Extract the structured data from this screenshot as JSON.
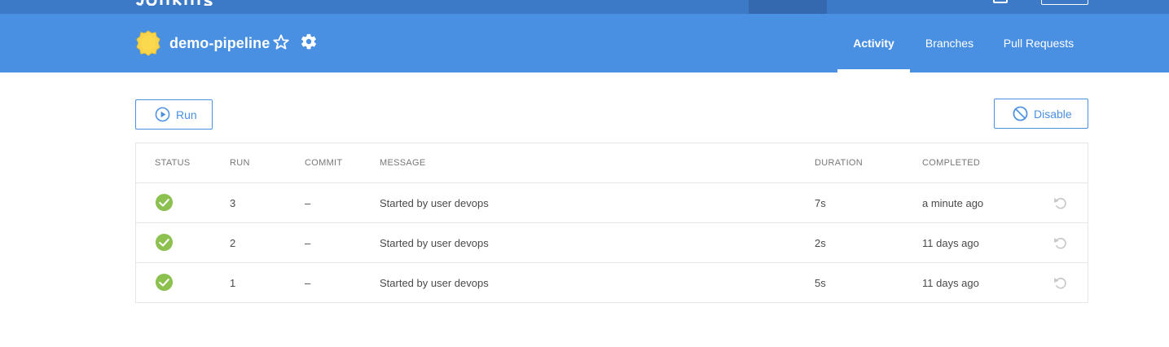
{
  "header": {
    "pipeline_name": "demo-pipeline",
    "weather_icon": "weather-sunny-icon",
    "favorite_icon": "star-outline-icon",
    "settings_icon": "gear-icon",
    "background_color": "#4a90e2",
    "tabs": [
      {
        "label": "Activity",
        "active": true
      },
      {
        "label": "Branches",
        "active": false
      },
      {
        "label": "Pull Requests",
        "active": false
      }
    ]
  },
  "actions": {
    "run_label": "Run",
    "run_icon": "play-circle-icon",
    "disable_label": "Disable",
    "disable_icon": "ban-icon"
  },
  "table": {
    "columns": [
      "STATUS",
      "RUN",
      "COMMIT",
      "MESSAGE",
      "DURATION",
      "COMPLETED"
    ],
    "rows": [
      {
        "status": "success",
        "run": "3",
        "commit": "–",
        "message": "Started by user devops",
        "duration": "7s",
        "completed": "a minute ago"
      },
      {
        "status": "success",
        "run": "2",
        "commit": "–",
        "message": "Started by user devops",
        "duration": "2s",
        "completed": "11 days ago"
      },
      {
        "status": "success",
        "run": "1",
        "commit": "–",
        "message": "Started by user devops",
        "duration": "5s",
        "completed": "11 days ago"
      }
    ]
  },
  "colors": {
    "accent": "#4a90e2",
    "success": "#8cc04f",
    "top_bar": "#3c79c6"
  }
}
